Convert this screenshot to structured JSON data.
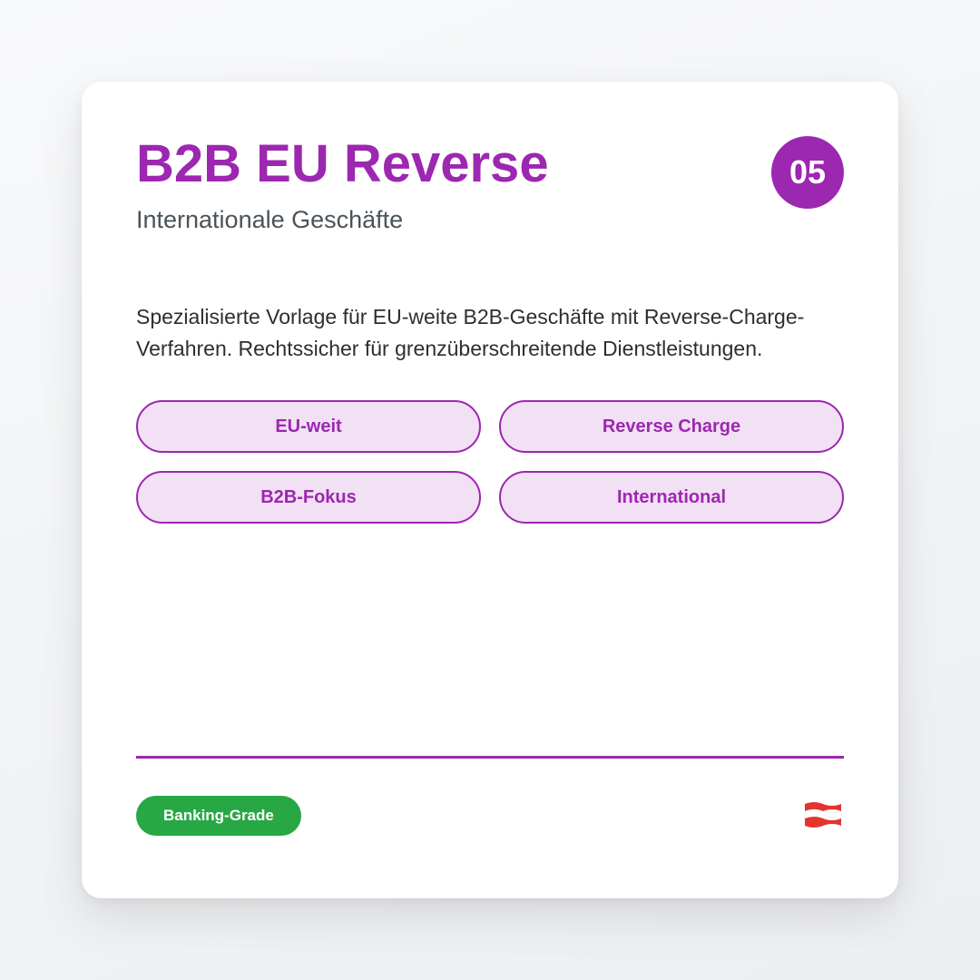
{
  "card": {
    "title": "B2B EU Reverse",
    "subtitle": "Internationale Geschäfte",
    "number": "05",
    "description": "Spezialisierte Vorlage für EU-weite B2B-Geschäfte mit Reverse-Charge-Verfahren. Rechtssicher für grenzüberschreitende Dienstleistungen.",
    "tags": [
      "EU-weit",
      "Reverse Charge",
      "B2B-Fokus",
      "International"
    ],
    "grade_badge": "Banking-Grade",
    "flag_icon": "austria-flag-icon"
  },
  "colors": {
    "accent": "#9c27b0",
    "tag_background": "#f2e0f4",
    "badge_green": "#28a745",
    "flag_red": "#e3342f",
    "flag_white": "#ffffff"
  }
}
